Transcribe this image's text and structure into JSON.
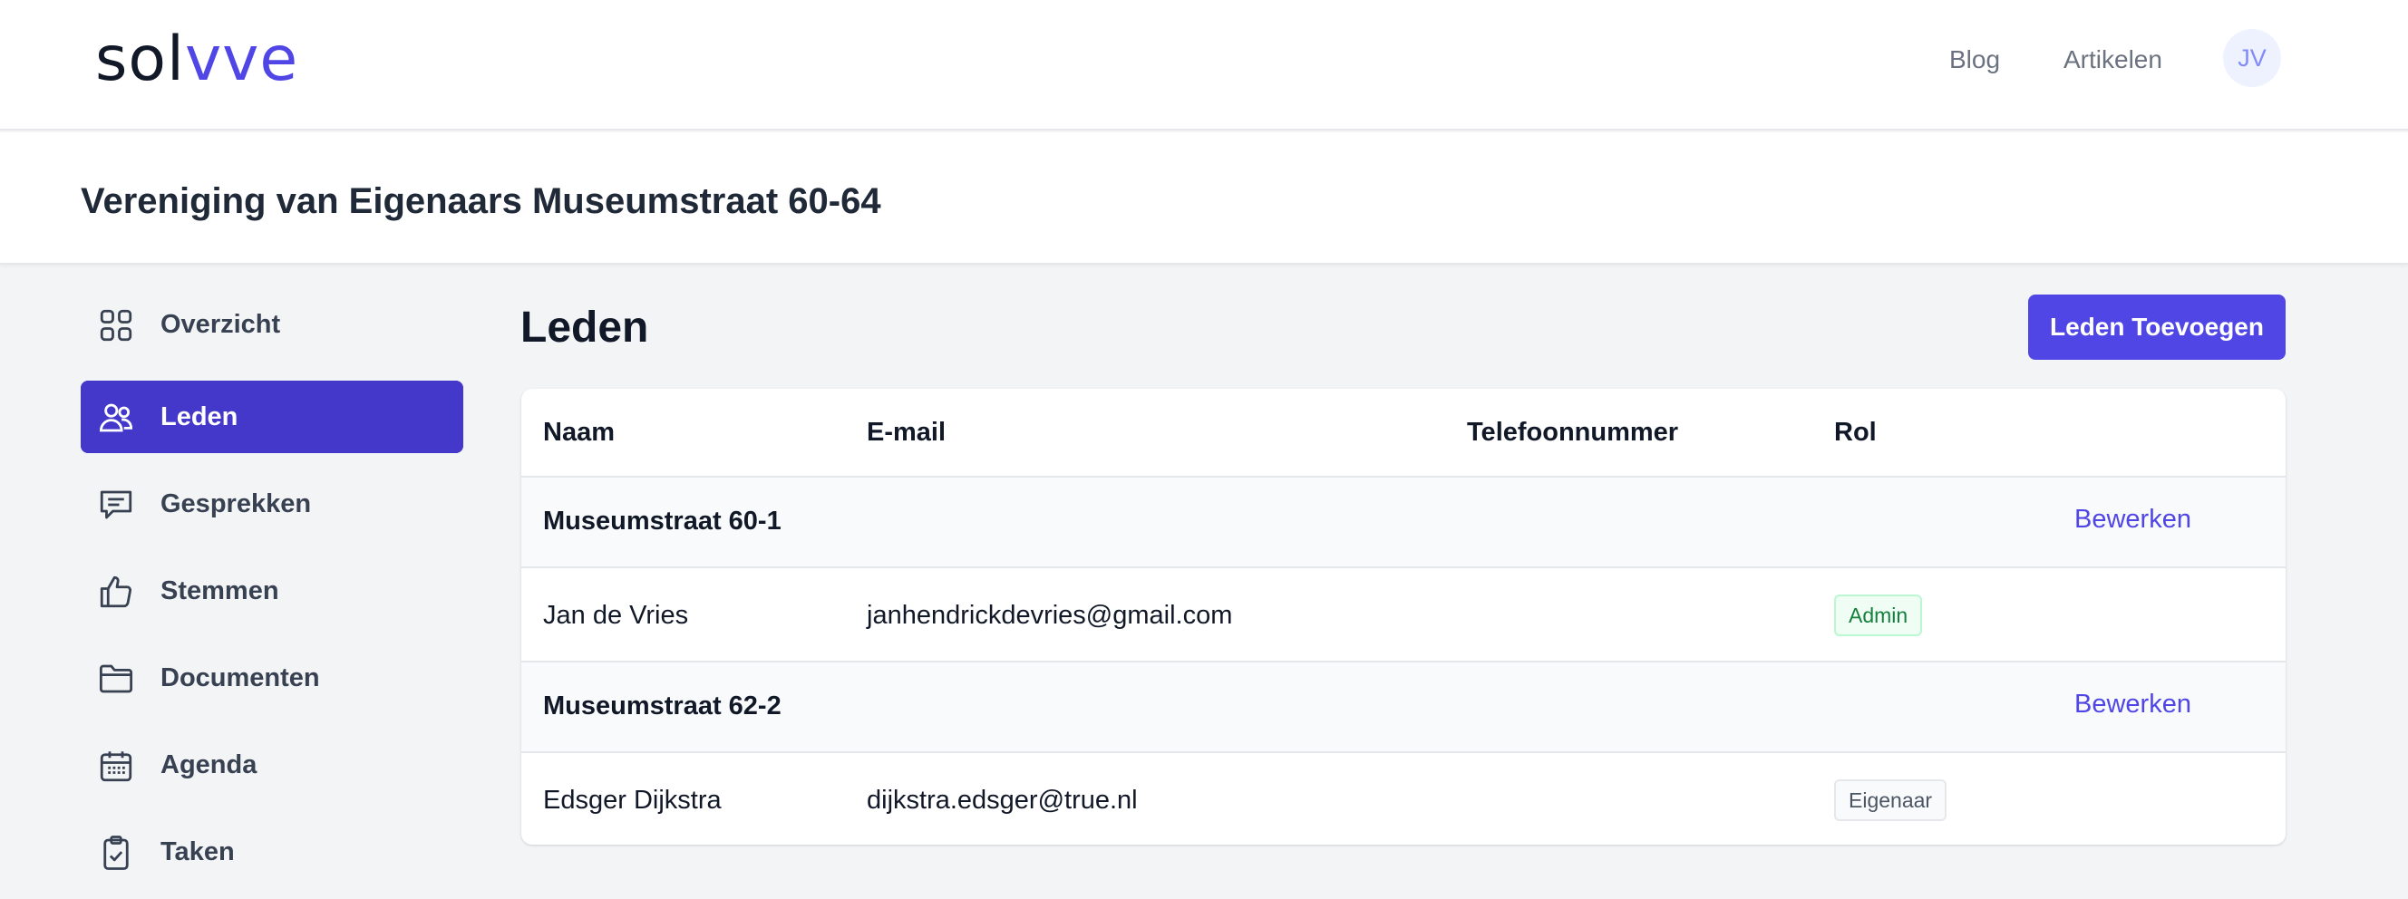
{
  "header": {
    "logo_part1": "sol",
    "logo_part2": "vve",
    "nav": [
      {
        "label": "Blog"
      },
      {
        "label": "Artikelen"
      }
    ],
    "avatar_initials": "JV"
  },
  "page": {
    "title": "Vereniging van Eigenaars Museumstraat 60-64"
  },
  "sidebar": {
    "items": [
      {
        "label": "Overzicht",
        "icon": "grid-icon"
      },
      {
        "label": "Leden",
        "icon": "users-icon",
        "active": true
      },
      {
        "label": "Gesprekken",
        "icon": "chat-icon"
      },
      {
        "label": "Stemmen",
        "icon": "thumbs-up-icon"
      },
      {
        "label": "Documenten",
        "icon": "folder-icon"
      },
      {
        "label": "Agenda",
        "icon": "calendar-icon"
      },
      {
        "label": "Taken",
        "icon": "clipboard-check-icon"
      }
    ]
  },
  "main": {
    "title": "Leden",
    "add_button": "Leden Toevoegen",
    "table": {
      "headers": [
        "Naam",
        "E-mail",
        "Telefoonnummer",
        "Rol"
      ],
      "groups": [
        {
          "name": "Museumstraat 60-1",
          "edit_label": "Bewerken",
          "members": [
            {
              "name": "Jan de Vries",
              "email": "janhendrickdevries@gmail.com",
              "phone": "",
              "role": "Admin"
            }
          ]
        },
        {
          "name": "Museumstraat 62-2",
          "edit_label": "Bewerken",
          "members": [
            {
              "name": "Edsger Dijkstra",
              "email": "dijkstra.edsger@true.nl",
              "phone": "",
              "role": "Eigenaar"
            }
          ]
        }
      ]
    }
  },
  "colors": {
    "accent": "#4f46e5",
    "sidebar_active": "#4338ca",
    "admin_badge": "#15803d"
  }
}
